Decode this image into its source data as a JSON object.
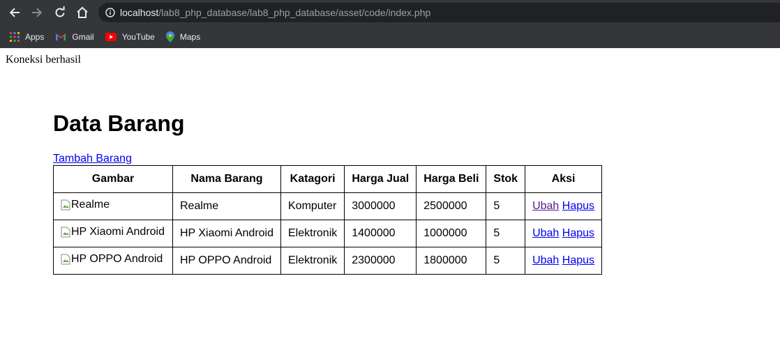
{
  "browser": {
    "url_host": "localhost",
    "url_path": "/lab8_php_database/lab8_php_database/asset/code/index.php",
    "bookmarks": [
      {
        "label": "Apps",
        "icon": "apps-grid-icon"
      },
      {
        "label": "Gmail",
        "icon": "gmail-icon"
      },
      {
        "label": "YouTube",
        "icon": "youtube-icon"
      },
      {
        "label": "Maps",
        "icon": "maps-icon"
      }
    ]
  },
  "page": {
    "status": "Koneksi berhasil",
    "title": "Data Barang",
    "add_link": "Tambah Barang",
    "table": {
      "headers": [
        "Gambar",
        "Nama Barang",
        "Katagori",
        "Harga Jual",
        "Harga Beli",
        "Stok",
        "Aksi"
      ],
      "rows": [
        {
          "gambar_alt": "Realme",
          "nama": "Realme",
          "kategori": "Komputer",
          "harga_jual": "3000000",
          "harga_beli": "2500000",
          "stok": "5",
          "ubah": "Ubah",
          "hapus": "Hapus"
        },
        {
          "gambar_alt": "HP Xiaomi Android",
          "nama": "HP Xiaomi Android",
          "kategori": "Elektronik",
          "harga_jual": "1400000",
          "harga_beli": "1000000",
          "stok": "5",
          "ubah": "Ubah",
          "hapus": "Hapus"
        },
        {
          "gambar_alt": "HP OPPO Android",
          "nama": "HP OPPO Android",
          "kategori": "Elektronik",
          "harga_jual": "2300000",
          "harga_beli": "1800000",
          "stok": "5",
          "ubah": "Ubah",
          "hapus": "Hapus"
        }
      ]
    }
  }
}
